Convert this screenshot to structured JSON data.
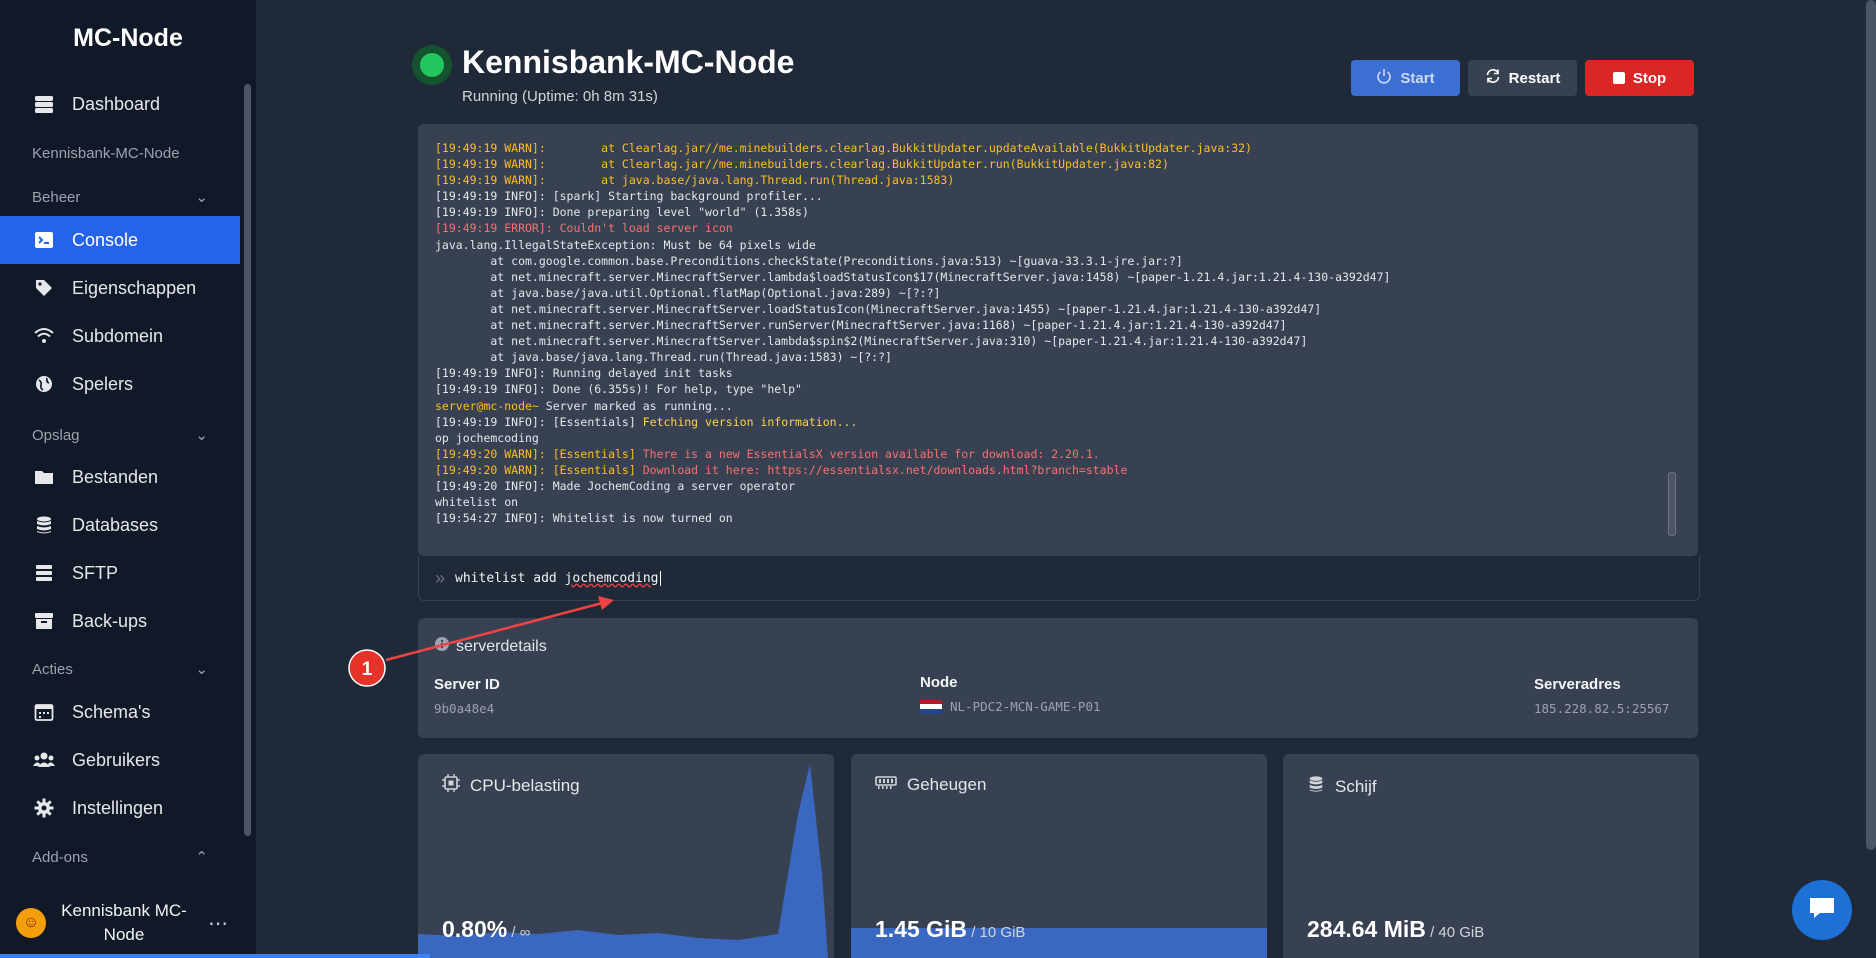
{
  "sidebar": {
    "brand": "MC-Node",
    "dashboard": "Dashboard",
    "server_name": "Kennisbank-MC-Node",
    "sections": {
      "beheer": "Beheer",
      "opslag": "Opslag",
      "acties": "Acties",
      "addons": "Add-ons"
    },
    "items": {
      "console": "Console",
      "eigenschappen": "Eigenschappen",
      "subdomein": "Subdomein",
      "spelers": "Spelers",
      "bestanden": "Bestanden",
      "databases": "Databases",
      "sftp": "SFTP",
      "backups": "Back-ups",
      "schemas": "Schema's",
      "gebruikers": "Gebruikers",
      "instellingen": "Instellingen"
    },
    "user": {
      "line1": "Kennisbank MC-",
      "line2": "Node"
    }
  },
  "header": {
    "title": "Kennisbank-MC-Node",
    "status": "Running (Uptime: 0h 8m 31s)",
    "start_label": "Start",
    "restart_label": "Restart",
    "stop_label": "Stop"
  },
  "console": {
    "lines": [
      {
        "text": "[19:49:19 WARN]:        at Clearlag.jar//me.minebuilders.clearlag.BukkitUpdater.updateAvailable(BukkitUpdater.java:32)",
        "level": "warn"
      },
      {
        "text": "[19:49:19 WARN]:        at Clearlag.jar//me.minebuilders.clearlag.BukkitUpdater.run(BukkitUpdater.java:82)",
        "level": "warn"
      },
      {
        "text": "[19:49:19 WARN]:        at java.base/java.lang.Thread.run(Thread.java:1583)",
        "level": "warn"
      },
      {
        "text": "[19:49:19 INFO]: [spark] Starting background profiler...",
        "level": "info"
      },
      {
        "text": "[19:49:19 INFO]: Done preparing level \"world\" (1.358s)",
        "level": "info"
      },
      {
        "text": "[19:49:19 ERROR]: Couldn't load server icon",
        "level": "error"
      },
      {
        "text": "java.lang.IllegalStateException: Must be 64 pixels wide",
        "level": "info"
      },
      {
        "text": "        at com.google.common.base.Preconditions.checkState(Preconditions.java:513) ~[guava-33.3.1-jre.jar:?]",
        "level": "info"
      },
      {
        "text": "        at net.minecraft.server.MinecraftServer.lambda$loadStatusIcon$17(MinecraftServer.java:1458) ~[paper-1.21.4.jar:1.21.4-130-a392d47]",
        "level": "info"
      },
      {
        "text": "        at java.base/java.util.Optional.flatMap(Optional.java:289) ~[?:?]",
        "level": "info"
      },
      {
        "text": "        at net.minecraft.server.MinecraftServer.loadStatusIcon(MinecraftServer.java:1455) ~[paper-1.21.4.jar:1.21.4-130-a392d47]",
        "level": "info"
      },
      {
        "text": "        at net.minecraft.server.MinecraftServer.runServer(MinecraftServer.java:1168) ~[paper-1.21.4.jar:1.21.4-130-a392d47]",
        "level": "info"
      },
      {
        "text": "        at net.minecraft.server.MinecraftServer.lambda$spin$2(MinecraftServer.java:310) ~[paper-1.21.4.jar:1.21.4-130-a392d47]",
        "level": "info"
      },
      {
        "text": "        at java.base/java.lang.Thread.run(Thread.java:1583) ~[?:?]",
        "level": "info"
      },
      {
        "text": "[19:49:19 INFO]: Running delayed init tasks",
        "level": "info"
      },
      {
        "text": "[19:49:19 INFO]: Done (6.355s)! For help, type \"help\"",
        "level": "info"
      },
      {
        "prefix": "server@mc-node~",
        "text": " Server marked as running...",
        "level": "prompt"
      },
      {
        "text": "[19:49:19 INFO]: [Essentials] ",
        "suffix": "Fetching version information...",
        "level": "info-yellow"
      },
      {
        "text": "op jochemcoding",
        "level": "info"
      },
      {
        "text": "[19:49:20 WARN]: [Essentials] ",
        "suffix": "There is a new EssentialsX version available for download: 2.20.1.",
        "level": "warn-red"
      },
      {
        "text": "[19:49:20 WARN]: [Essentials] ",
        "suffix": "Download it here: https://essentialsx.net/downloads.html?branch=stable",
        "level": "warn-red"
      },
      {
        "text": "[19:49:20 INFO]: Made JochemCoding a server operator",
        "level": "info"
      },
      {
        "text": "whitelist on",
        "level": "info"
      },
      {
        "text": "[19:54:27 INFO]: Whitelist is now turned on",
        "level": "info"
      }
    ],
    "command_prefix": "whitelist add ",
    "command_word": "jochemcoding"
  },
  "annotation": {
    "number": "1"
  },
  "details": {
    "title": "serverdetails",
    "server_id_label": "Server ID",
    "server_id": "9b0a48e4",
    "node_label": "Node",
    "node": "NL-PDC2-MCN-GAME-P01",
    "address_label": "Serveradres",
    "address": "185.228.82.5:25567"
  },
  "metrics": {
    "cpu": {
      "title": "CPU-belasting",
      "value": "0.80%",
      "limit": " / ∞",
      "fraction": 0.008
    },
    "memory": {
      "title": "Geheugen",
      "value": "1.45 GiB",
      "limit": " / 10 GiB",
      "fraction": 0.145
    },
    "disk": {
      "title": "Schijf",
      "value": "284.64 MiB",
      "limit": " / 40 GiB",
      "fraction": 0.007
    }
  },
  "colors": {
    "accent": "#2563eb",
    "success": "#22c55e",
    "danger": "#dc2626",
    "graph": "#3b6fd4"
  },
  "icons": {
    "dashboard": "server-stack-icon",
    "console": "terminal-icon",
    "eigenschappen": "tag-icon",
    "subdomein": "wifi-icon",
    "spelers": "globe-icon",
    "bestanden": "folder-icon",
    "databases": "database-icon",
    "sftp": "layers-icon",
    "backups": "archive-icon",
    "schemas": "calendar-icon",
    "gebruikers": "users-icon",
    "instellingen": "gear-icon"
  }
}
